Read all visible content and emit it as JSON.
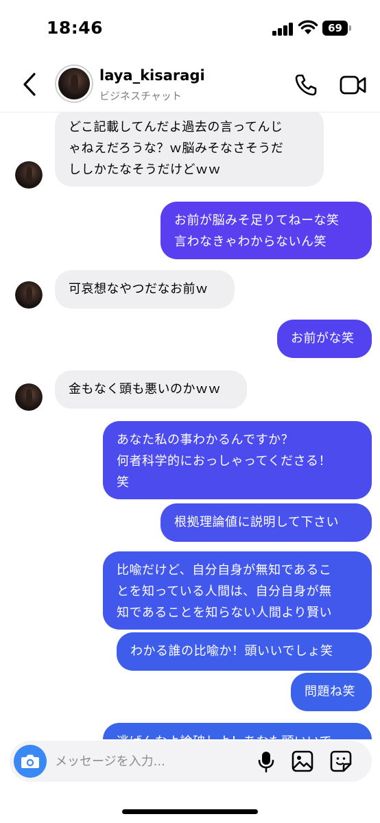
{
  "status_bar": {
    "time": "18:46",
    "battery": "69"
  },
  "header": {
    "username": "laya_kisaragi",
    "subtitle": "ビジネスチャット"
  },
  "messages": [
    {
      "dir": "in",
      "text": "どこ記載してんだよ過去の言ってんじ\nゃねえだろうな？ｗ脳みそなさそうだ\nししかたなそうだけどｗｗ"
    },
    {
      "dir": "out",
      "text": "お前が脳みそ足りてねーな笑\n言わなきゃわからないん笑"
    },
    {
      "dir": "in",
      "text": "可哀想なやつだなお前ｗ"
    },
    {
      "dir": "out",
      "text": "お前がな笑"
    },
    {
      "dir": "in",
      "text": "金もなく頭も悪いのかｗｗ"
    },
    {
      "dir": "out",
      "text": "あなた私の事わかるんですか？\n何者科学的におっしゃってくださる！\n笑"
    },
    {
      "dir": "out",
      "text": "根拠理論値に説明して下さい"
    },
    {
      "dir": "out",
      "text": "比喩だけど、自分自身が無知であるこ\nとを知っている人間は、自分自身が無\n知であることを知らない人間より賢い"
    },
    {
      "dir": "out",
      "text": "わかる誰の比喩か！頭いいでしょ笑"
    },
    {
      "dir": "out",
      "text": "問題ね笑"
    },
    {
      "dir": "out",
      "text": "逃げんなよ論破しよ！あなた頭いいで"
    }
  ],
  "composer": {
    "placeholder": "メッセージを入力..."
  },
  "colors": {
    "outgoing_top": "#5b3ef2",
    "outgoing_bottom": "#3a62ea",
    "incoming": "#efeff1",
    "camera": "#3a88f4"
  }
}
